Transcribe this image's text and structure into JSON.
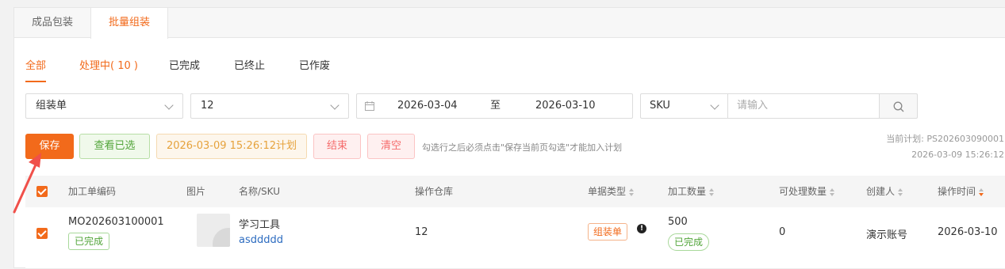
{
  "tabs": [
    "成品包装",
    "批量组装"
  ],
  "status_tabs": [
    "全部",
    "处理中( 10 )",
    "已完成",
    "已终止",
    "已作废"
  ],
  "filters": {
    "type_select": "组装单",
    "count_select": "12",
    "date_start": "2026-03-04",
    "date_sep": "至",
    "date_end": "2026-03-10",
    "field_select": "SKU",
    "search_placeholder": "请输入"
  },
  "actions": {
    "save": "保存",
    "view_selected": "查看已选",
    "plan": "2026-03-09 15:26:12计划",
    "end": "结束",
    "clear": "清空",
    "hint": "勾选行之后必须点击\"保存当前页勾选\"才能加入计划"
  },
  "plan_info": {
    "current": "当前计划: PS202603090001",
    "time": "2026-03-09 15:26:12"
  },
  "table": {
    "headers": [
      "加工单编码",
      "图片",
      "名称/SKU",
      "操作仓库",
      "单据类型",
      "加工数量",
      "可处理数量",
      "创建人",
      "操作时间"
    ],
    "rows": [
      {
        "code": "MO202603100001",
        "code_status": "已完成",
        "name": "学习工具",
        "sku": "asddddd",
        "warehouse": "12",
        "doc_type": "组装单",
        "qty": "500",
        "qty_status": "已完成",
        "processable": "0",
        "creator": "演示账号",
        "time": "2026-03-10"
      }
    ]
  },
  "colors": {
    "accent": "#f26a1b",
    "success": "#52a53a",
    "danger": "#f56c6c",
    "warning": "#e6a23c"
  }
}
